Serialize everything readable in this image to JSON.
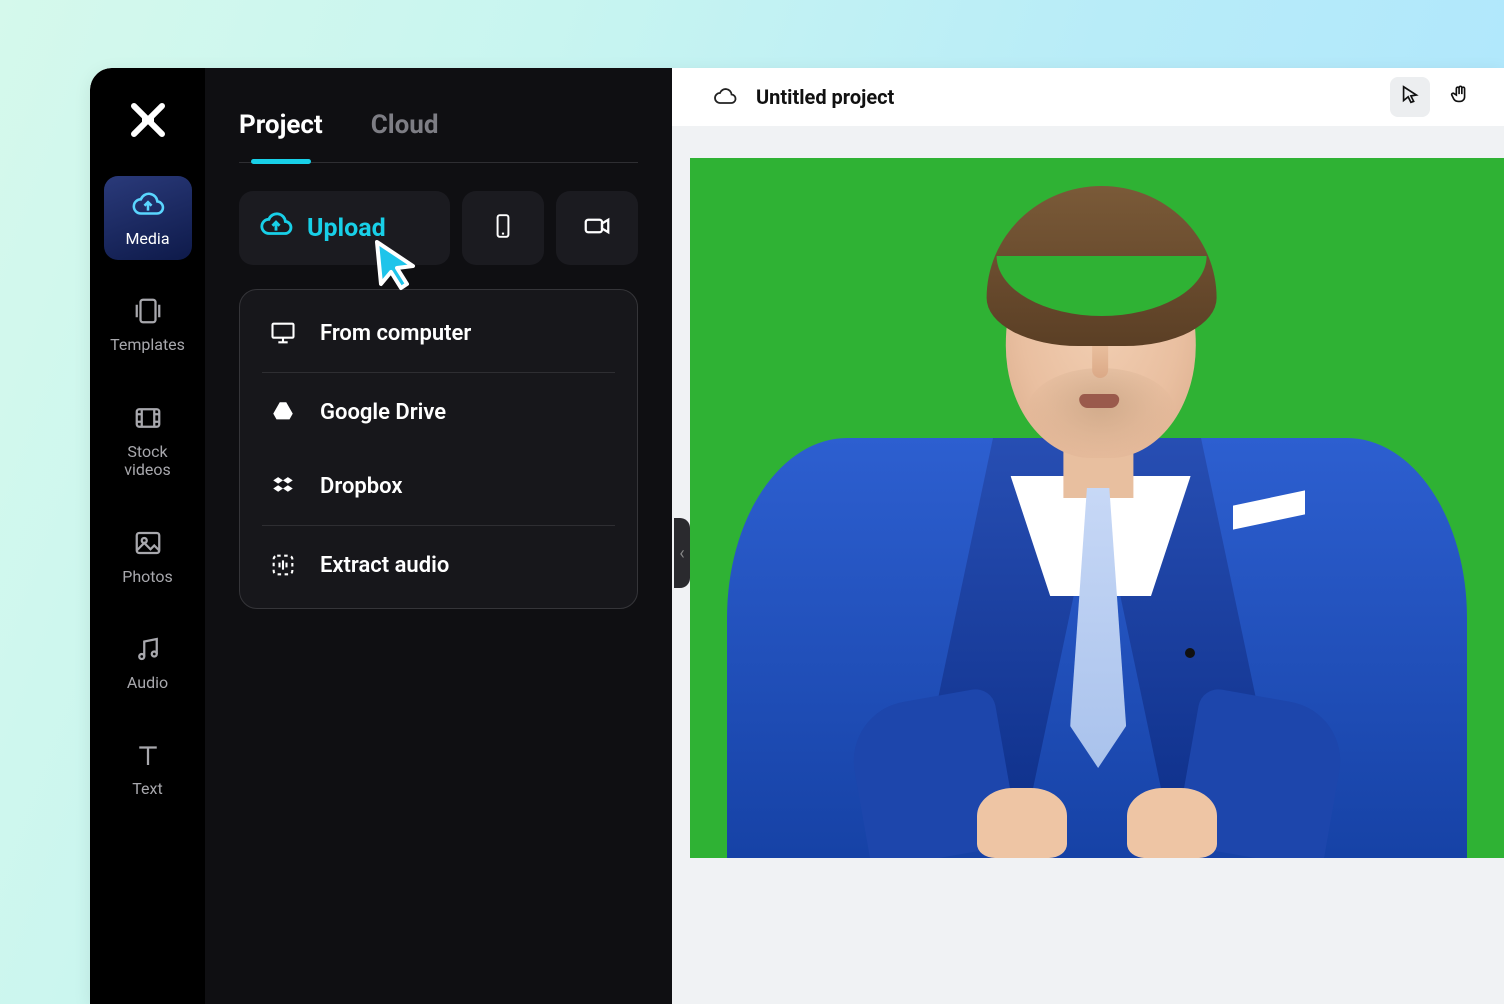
{
  "iconbar": {
    "items": [
      {
        "id": "media",
        "label": "Media",
        "active": true
      },
      {
        "id": "templates",
        "label": "Templates",
        "active": false
      },
      {
        "id": "stock-videos",
        "label": "Stock videos",
        "active": false
      },
      {
        "id": "photos",
        "label": "Photos",
        "active": false
      },
      {
        "id": "audio",
        "label": "Audio",
        "active": false
      },
      {
        "id": "text",
        "label": "Text",
        "active": false
      }
    ]
  },
  "media_tabs": {
    "project": "Project",
    "cloud": "Cloud",
    "active": "project"
  },
  "upload": {
    "button_label": "Upload",
    "dropdown": {
      "from_computer": "From computer",
      "google_drive": "Google Drive",
      "dropbox": "Dropbox",
      "extract_audio": "Extract audio"
    }
  },
  "topbar": {
    "project_title": "Untitled project"
  },
  "canvas": {
    "background": "greenscreen",
    "content_description": "man in blue suit with tie on green screen"
  },
  "colors": {
    "accent": "#18d0e8",
    "greenscreen": "#2fb234",
    "suit": "#1d46ac"
  }
}
